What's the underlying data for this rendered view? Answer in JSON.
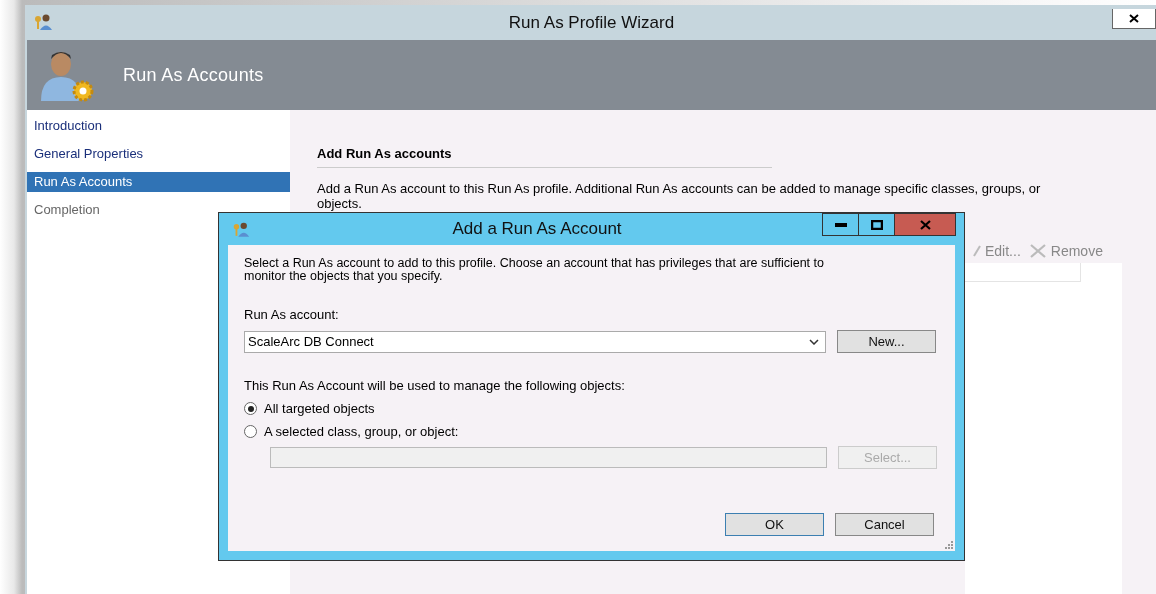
{
  "window": {
    "title": "Run As Profile Wizard"
  },
  "header": {
    "title": "Run As Accounts"
  },
  "steps": [
    {
      "label": "Introduction",
      "selected": false,
      "visited": true
    },
    {
      "label": "General Properties",
      "selected": false,
      "visited": true
    },
    {
      "label": "Run As Accounts",
      "selected": true,
      "visited": true
    },
    {
      "label": "Completion",
      "selected": false,
      "visited": false
    }
  ],
  "page": {
    "heading": "Add Run As accounts",
    "description": "Add a Run As account to this Run As profile.  Additional Run As accounts can be added to manage specific classes, groups, or objects.",
    "toolbar": [
      {
        "label": "Edit...",
        "kind": "edit"
      },
      {
        "label": "Remove",
        "kind": "remove"
      }
    ]
  },
  "dialog": {
    "title": "Add a Run As Account",
    "intro": "Select a Run As account to add to this profile.  Choose an account that has privileges that are sufficient to monitor the objects that you specify.",
    "account_label": "Run As account:",
    "account": {
      "value": "ScaleArc DB Connect"
    },
    "new_button": "New...",
    "scope_label": "This Run As Account will be used to manage the following objects:",
    "options": [
      {
        "label": "All targeted objects",
        "selected": true
      },
      {
        "label": "A selected class, group, or object:",
        "selected": false
      }
    ],
    "selector": {
      "disabled": true
    },
    "select_button": {
      "label": "Select...",
      "disabled": true
    },
    "buttons": [
      {
        "label": "OK",
        "default": true
      },
      {
        "label": "Cancel",
        "default": false
      }
    ]
  }
}
